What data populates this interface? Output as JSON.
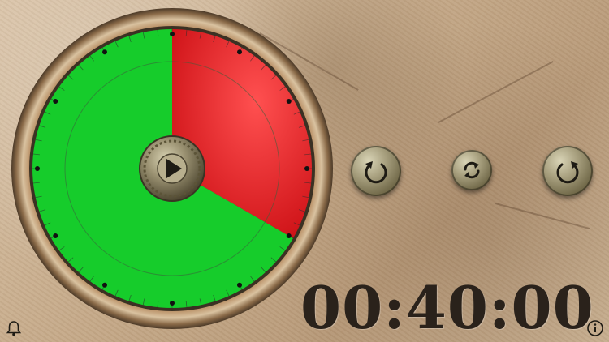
{
  "timer": {
    "display": "00:40:00",
    "remaining_fraction": 0.6667
  },
  "colors": {
    "elapsed": "#e31d22",
    "remaining": "#16cc2b",
    "text": "#2a221b",
    "stone": "#c9ae8e"
  },
  "dial": {
    "play_icon": "play-icon",
    "major_ticks": 12,
    "minor_ticks": 60
  },
  "controls": {
    "rotate_left_icon": "rotate-counterclockwise-icon",
    "swap_icon": "swap-direction-icon",
    "rotate_right_icon": "rotate-clockwise-icon",
    "alarm_icon": "bell-icon",
    "info_icon": "info-icon"
  }
}
